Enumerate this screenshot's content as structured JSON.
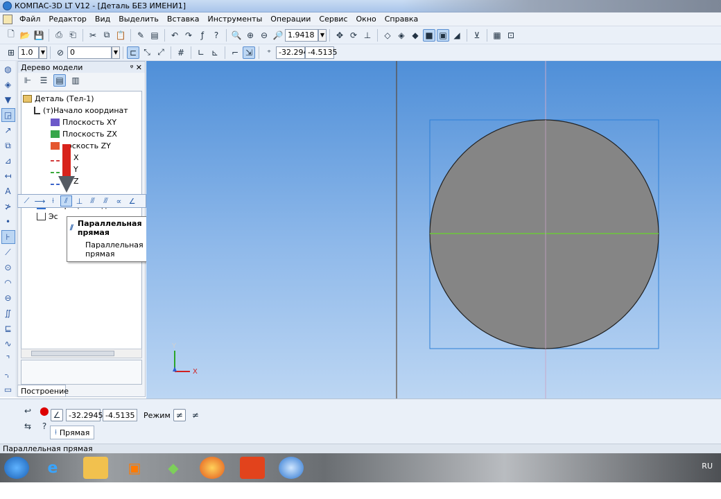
{
  "window": {
    "title": "КОМПАС-3D LT V12 - [Деталь БЕЗ ИМЕНИ1]"
  },
  "menu": [
    "Файл",
    "Редактор",
    "Вид",
    "Выделить",
    "Вставка",
    "Инструменты",
    "Операции",
    "Сервис",
    "Окно",
    "Справка"
  ],
  "toolbar1": {
    "zoom_value": "1.9418"
  },
  "toolbar2": {
    "line_scale": "1.0",
    "layer": "0",
    "coord_x": "-32.294",
    "coord_y": "-4.5135"
  },
  "model_tree": {
    "header": "Дерево модели",
    "items": [
      "Деталь (Тел-1)",
      "(т)Начало координат",
      "Плоскость XY",
      "Плоскость ZX",
      "лоскость ZY",
      "сь X",
      "сь Y",
      "сь Z",
      "Операция выдавливания",
      "Эс"
    ],
    "tab_label": "Построение"
  },
  "tooltip": {
    "title": "Параллельная прямая",
    "subtitle": "Параллельная прямая"
  },
  "params": {
    "x": "-32.2945",
    "y": "-4.5135",
    "mode_label": "Режим",
    "tab_label": "Прямая"
  },
  "status": {
    "text": "Параллельная прямая"
  },
  "taskbar": {
    "language": "RU"
  },
  "axes": {
    "x_label": "X",
    "y_label": "Y"
  },
  "colors": {
    "circle_fill": "#858585",
    "bbox": "#2d7fd6",
    "green_line": "#6dc83a",
    "arrow_red": "#d8231c",
    "arrow_gray": "#555b63"
  }
}
